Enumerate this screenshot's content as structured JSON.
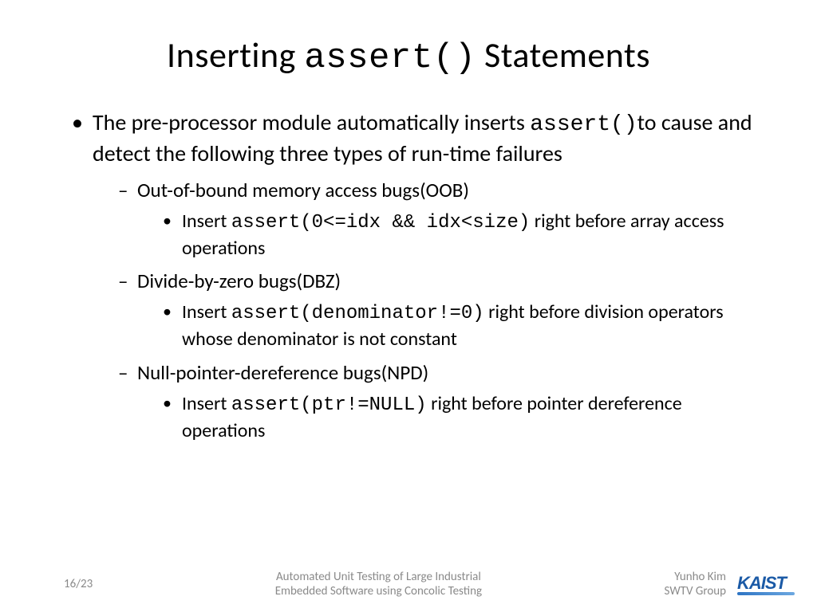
{
  "title": {
    "part1": "Inserting ",
    "mono": "assert()",
    "part2": " Statements"
  },
  "bullet1": {
    "t1": "The pre-processor module automatically inserts ",
    "mono": "assert()",
    "t2": "to cause and detect the following three types of run-time failures"
  },
  "sub1": {
    "label": "Out-of-bound memory access bugs(OOB)",
    "sub_t1": "Insert ",
    "sub_mono": "assert(0<=idx && idx<size)",
    "sub_t2": " right before array access operations"
  },
  "sub2": {
    "label": "Divide-by-zero bugs(DBZ)",
    "sub_t1": "Insert ",
    "sub_mono": "assert(denominator!=0)",
    "sub_t2": " right before division operators whose denominator is not constant"
  },
  "sub3": {
    "label": "Null-pointer-dereference bugs(NPD)",
    "sub_t1": "Insert ",
    "sub_mono": "assert(ptr!=NULL)",
    "sub_t2": " right before pointer dereference operations"
  },
  "footer": {
    "page": "16/23",
    "center1": "Automated Unit Testing of Large Industrial",
    "center2": "Embedded Software using Concolic Testing",
    "right1": "Yunho Kim",
    "right2": "SWTV Group",
    "logo": "KAIST"
  }
}
